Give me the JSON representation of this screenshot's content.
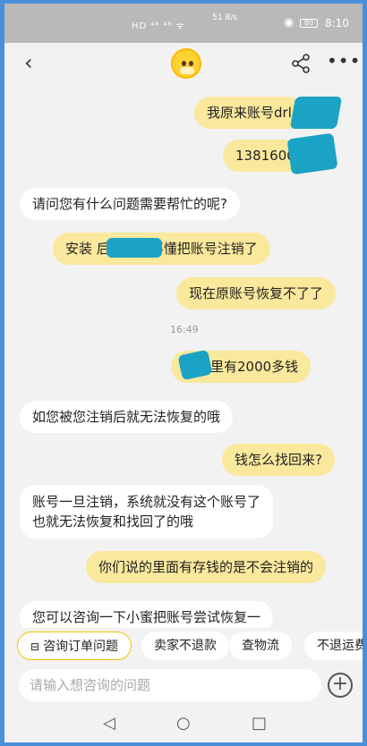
{
  "status_bar": {
    "indicators": "HD ⁴⁶ ⁴⁶ ᯤ",
    "speed": "51 B/s",
    "battery": "80",
    "time": "8:10"
  },
  "header": {
    "back_icon": "chevron-left-icon",
    "avatar_icon": "mascot-icon",
    "share_icon": "share-icon",
    "more_icon": "more-horizontal-icon"
  },
  "messages": [
    {
      "side": "out",
      "text": "我原来账号drl"
    },
    {
      "side": "out",
      "text": "1381600"
    },
    {
      "side": "in",
      "text": "请问您有什么问题需要帮忙的呢?"
    },
    {
      "side": "out",
      "text": "安装      后卸载，不懂把账号注销了"
    },
    {
      "side": "out",
      "text": "现在原账号恢复不了了"
    },
    {
      "side": "out",
      "text": "  超市里有2000多钱"
    },
    {
      "side": "in",
      "text": "如您被您注销后就无法恢复的哦"
    },
    {
      "side": "out",
      "text": "钱怎么找回来?"
    },
    {
      "side": "in",
      "text": "账号一旦注销，系统就没有这个账号了"
    },
    {
      "side": "in",
      "text": "也就无法恢复和找回了的哦"
    },
    {
      "side": "out",
      "text": "你们说的里面有存钱的是不会注销的"
    },
    {
      "side": "in",
      "text": "您可以咨询一下小蜜把账号尝试恢复一"
    }
  ],
  "timestamp": "16:49",
  "quick_replies": [
    "咨询订单问题",
    "卖家不退款",
    "查物流",
    "不退运费"
  ],
  "input": {
    "placeholder": "请输入想咨询的问题"
  },
  "nav": {
    "back": "◁",
    "home": "○",
    "recent": "□"
  }
}
